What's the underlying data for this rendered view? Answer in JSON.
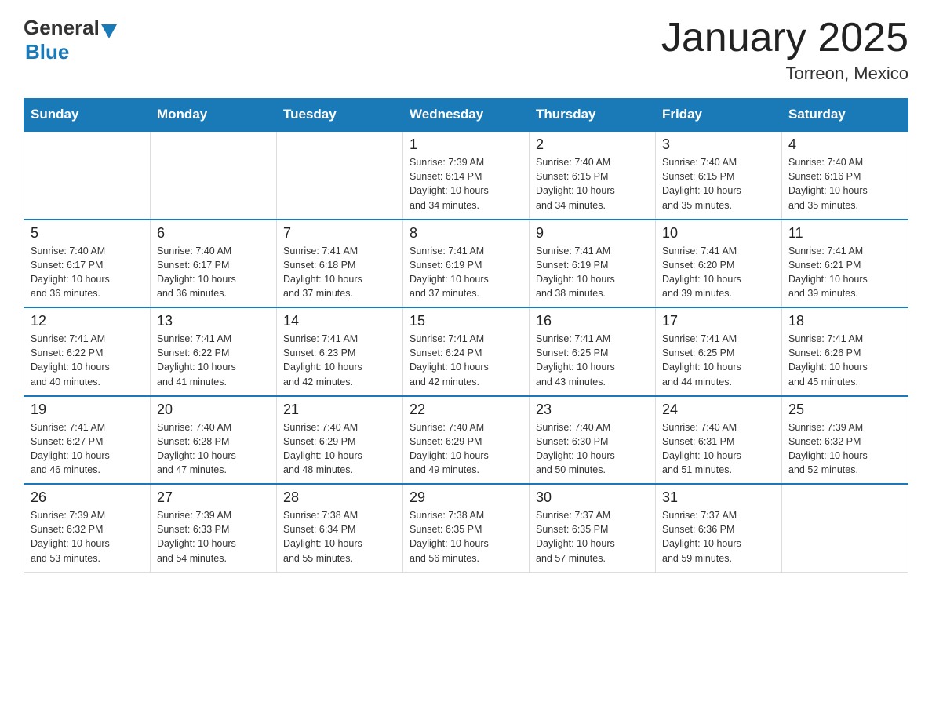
{
  "header": {
    "logo_general": "General",
    "logo_blue": "Blue",
    "title": "January 2025",
    "subtitle": "Torreon, Mexico"
  },
  "days_of_week": [
    "Sunday",
    "Monday",
    "Tuesday",
    "Wednesday",
    "Thursday",
    "Friday",
    "Saturday"
  ],
  "weeks": [
    [
      {
        "day": "",
        "info": ""
      },
      {
        "day": "",
        "info": ""
      },
      {
        "day": "",
        "info": ""
      },
      {
        "day": "1",
        "info": "Sunrise: 7:39 AM\nSunset: 6:14 PM\nDaylight: 10 hours\nand 34 minutes."
      },
      {
        "day": "2",
        "info": "Sunrise: 7:40 AM\nSunset: 6:15 PM\nDaylight: 10 hours\nand 34 minutes."
      },
      {
        "day": "3",
        "info": "Sunrise: 7:40 AM\nSunset: 6:15 PM\nDaylight: 10 hours\nand 35 minutes."
      },
      {
        "day": "4",
        "info": "Sunrise: 7:40 AM\nSunset: 6:16 PM\nDaylight: 10 hours\nand 35 minutes."
      }
    ],
    [
      {
        "day": "5",
        "info": "Sunrise: 7:40 AM\nSunset: 6:17 PM\nDaylight: 10 hours\nand 36 minutes."
      },
      {
        "day": "6",
        "info": "Sunrise: 7:40 AM\nSunset: 6:17 PM\nDaylight: 10 hours\nand 36 minutes."
      },
      {
        "day": "7",
        "info": "Sunrise: 7:41 AM\nSunset: 6:18 PM\nDaylight: 10 hours\nand 37 minutes."
      },
      {
        "day": "8",
        "info": "Sunrise: 7:41 AM\nSunset: 6:19 PM\nDaylight: 10 hours\nand 37 minutes."
      },
      {
        "day": "9",
        "info": "Sunrise: 7:41 AM\nSunset: 6:19 PM\nDaylight: 10 hours\nand 38 minutes."
      },
      {
        "day": "10",
        "info": "Sunrise: 7:41 AM\nSunset: 6:20 PM\nDaylight: 10 hours\nand 39 minutes."
      },
      {
        "day": "11",
        "info": "Sunrise: 7:41 AM\nSunset: 6:21 PM\nDaylight: 10 hours\nand 39 minutes."
      }
    ],
    [
      {
        "day": "12",
        "info": "Sunrise: 7:41 AM\nSunset: 6:22 PM\nDaylight: 10 hours\nand 40 minutes."
      },
      {
        "day": "13",
        "info": "Sunrise: 7:41 AM\nSunset: 6:22 PM\nDaylight: 10 hours\nand 41 minutes."
      },
      {
        "day": "14",
        "info": "Sunrise: 7:41 AM\nSunset: 6:23 PM\nDaylight: 10 hours\nand 42 minutes."
      },
      {
        "day": "15",
        "info": "Sunrise: 7:41 AM\nSunset: 6:24 PM\nDaylight: 10 hours\nand 42 minutes."
      },
      {
        "day": "16",
        "info": "Sunrise: 7:41 AM\nSunset: 6:25 PM\nDaylight: 10 hours\nand 43 minutes."
      },
      {
        "day": "17",
        "info": "Sunrise: 7:41 AM\nSunset: 6:25 PM\nDaylight: 10 hours\nand 44 minutes."
      },
      {
        "day": "18",
        "info": "Sunrise: 7:41 AM\nSunset: 6:26 PM\nDaylight: 10 hours\nand 45 minutes."
      }
    ],
    [
      {
        "day": "19",
        "info": "Sunrise: 7:41 AM\nSunset: 6:27 PM\nDaylight: 10 hours\nand 46 minutes."
      },
      {
        "day": "20",
        "info": "Sunrise: 7:40 AM\nSunset: 6:28 PM\nDaylight: 10 hours\nand 47 minutes."
      },
      {
        "day": "21",
        "info": "Sunrise: 7:40 AM\nSunset: 6:29 PM\nDaylight: 10 hours\nand 48 minutes."
      },
      {
        "day": "22",
        "info": "Sunrise: 7:40 AM\nSunset: 6:29 PM\nDaylight: 10 hours\nand 49 minutes."
      },
      {
        "day": "23",
        "info": "Sunrise: 7:40 AM\nSunset: 6:30 PM\nDaylight: 10 hours\nand 50 minutes."
      },
      {
        "day": "24",
        "info": "Sunrise: 7:40 AM\nSunset: 6:31 PM\nDaylight: 10 hours\nand 51 minutes."
      },
      {
        "day": "25",
        "info": "Sunrise: 7:39 AM\nSunset: 6:32 PM\nDaylight: 10 hours\nand 52 minutes."
      }
    ],
    [
      {
        "day": "26",
        "info": "Sunrise: 7:39 AM\nSunset: 6:32 PM\nDaylight: 10 hours\nand 53 minutes."
      },
      {
        "day": "27",
        "info": "Sunrise: 7:39 AM\nSunset: 6:33 PM\nDaylight: 10 hours\nand 54 minutes."
      },
      {
        "day": "28",
        "info": "Sunrise: 7:38 AM\nSunset: 6:34 PM\nDaylight: 10 hours\nand 55 minutes."
      },
      {
        "day": "29",
        "info": "Sunrise: 7:38 AM\nSunset: 6:35 PM\nDaylight: 10 hours\nand 56 minutes."
      },
      {
        "day": "30",
        "info": "Sunrise: 7:37 AM\nSunset: 6:35 PM\nDaylight: 10 hours\nand 57 minutes."
      },
      {
        "day": "31",
        "info": "Sunrise: 7:37 AM\nSunset: 6:36 PM\nDaylight: 10 hours\nand 59 minutes."
      },
      {
        "day": "",
        "info": ""
      }
    ]
  ]
}
